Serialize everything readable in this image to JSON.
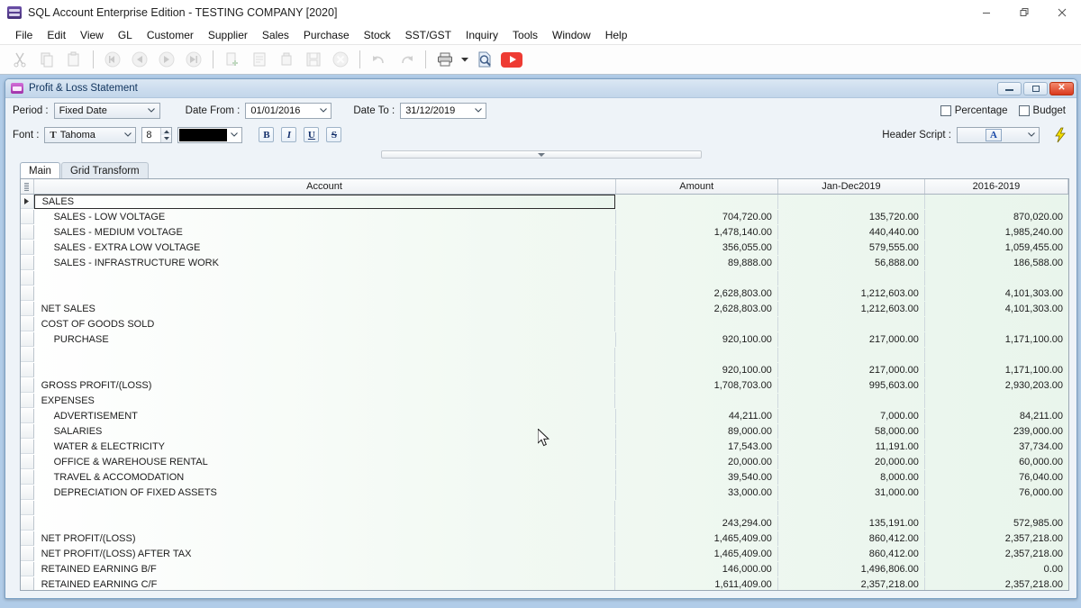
{
  "window": {
    "title": "SQL Account Enterprise Edition - TESTING COMPANY [2020]",
    "app_icon": "sql-account-icon",
    "controls": {
      "minimize": "minimize-icon",
      "restore": "restore-icon",
      "close": "close-icon"
    }
  },
  "menubar": {
    "items": [
      {
        "label": "File",
        "accel": "F"
      },
      {
        "label": "Edit",
        "accel": "E"
      },
      {
        "label": "View",
        "accel": "V"
      },
      {
        "label": "GL",
        "accel": "L"
      },
      {
        "label": "Customer",
        "accel": "C"
      },
      {
        "label": "Supplier",
        "accel": "u"
      },
      {
        "label": "Sales",
        "accel": "S"
      },
      {
        "label": "Purchase",
        "accel": "P"
      },
      {
        "label": "Stock",
        "accel": "k"
      },
      {
        "label": "SST/GST",
        "accel": "G"
      },
      {
        "label": "Inquiry",
        "accel": "I"
      },
      {
        "label": "Tools",
        "accel": "T"
      },
      {
        "label": "Window",
        "accel": "W"
      },
      {
        "label": "Help",
        "accel": "H"
      }
    ]
  },
  "toolbar": {
    "buttons": [
      {
        "name": "cut-icon",
        "enabled": false
      },
      {
        "name": "copy-icon",
        "enabled": false
      },
      {
        "name": "paste-icon",
        "enabled": false
      },
      {
        "name": "first-record-icon",
        "enabled": false
      },
      {
        "name": "previous-record-icon",
        "enabled": false
      },
      {
        "name": "next-record-icon",
        "enabled": false
      },
      {
        "name": "last-record-icon",
        "enabled": false
      },
      {
        "name": "add-record-icon",
        "enabled": false
      },
      {
        "name": "edit-record-icon",
        "enabled": false
      },
      {
        "name": "delete-record-icon",
        "enabled": false
      },
      {
        "name": "save-record-icon",
        "enabled": false
      },
      {
        "name": "cancel-record-icon",
        "enabled": false
      },
      {
        "name": "undo-icon",
        "enabled": false
      },
      {
        "name": "redo-icon",
        "enabled": false
      },
      {
        "name": "print-icon",
        "enabled": true
      },
      {
        "name": "print-preview-icon",
        "enabled": true
      },
      {
        "name": "youtube-icon",
        "enabled": true
      }
    ]
  },
  "report_window": {
    "title": "Profit & Loss Statement",
    "icon": "report-window-icon",
    "controls": {
      "minimize": "minimize-icon",
      "maximize": "maximize-icon",
      "close": "close-icon"
    },
    "params": {
      "period_label": "Period :",
      "period_value": "Fixed Date",
      "date_from_label": "Date From :",
      "date_from_value": "01/01/2016",
      "date_to_label": "Date To :",
      "date_to_value": "31/12/2019",
      "percentage_label": "Percentage",
      "percentage_checked": false,
      "budget_label": "Budget",
      "budget_checked": false
    },
    "format_bar": {
      "font_label": "Font :",
      "font_value": "Tahoma",
      "font_icon": "font-type-icon",
      "size_value": "8",
      "color_value": "#000000",
      "bold_label": "B",
      "italic_label": "I",
      "underline_label": "U",
      "strikeout_label": "S",
      "header_script_label": "Header Script :",
      "header_script_value": "A",
      "script_run_icon": "lightning-bolt-icon"
    },
    "tabs": [
      {
        "label": "Main",
        "active": true
      },
      {
        "label": "Grid Transform",
        "active": false
      }
    ]
  },
  "grid": {
    "columns": [
      "Account",
      "Amount",
      "Jan-Dec2019",
      "2016-2019"
    ],
    "rows": [
      {
        "type": "header",
        "account": "SALES",
        "amount": "",
        "jan": "",
        "y2016": "",
        "selected": true
      },
      {
        "type": "detail",
        "account": "SALES - LOW VOLTAGE",
        "amount": "704,720.00",
        "jan": "135,720.00",
        "y2016": "870,020.00"
      },
      {
        "type": "detail",
        "account": "SALES - MEDIUM VOLTAGE",
        "amount": "1,478,140.00",
        "jan": "440,440.00",
        "y2016": "1,985,240.00"
      },
      {
        "type": "detail",
        "account": "SALES - EXTRA LOW VOLTAGE",
        "amount": "356,055.00",
        "jan": "579,555.00",
        "y2016": "1,059,455.00"
      },
      {
        "type": "detail",
        "account": "SALES - INFRASTRUCTURE WORK",
        "amount": "89,888.00",
        "jan": "56,888.00",
        "y2016": "186,588.00"
      },
      {
        "type": "total",
        "account": "",
        "amount": "2,628,803.00",
        "jan": "1,212,603.00",
        "y2016": "4,101,303.00"
      },
      {
        "type": "header",
        "account": "NET SALES",
        "amount": "2,628,803.00",
        "jan": "1,212,603.00",
        "y2016": "4,101,303.00"
      },
      {
        "type": "header",
        "account": "COST OF GOODS SOLD",
        "amount": "",
        "jan": "",
        "y2016": ""
      },
      {
        "type": "detail",
        "account": "PURCHASE",
        "amount": "920,100.00",
        "jan": "217,000.00",
        "y2016": "1,171,100.00"
      },
      {
        "type": "total",
        "account": "",
        "amount": "920,100.00",
        "jan": "217,000.00",
        "y2016": "1,171,100.00"
      },
      {
        "type": "header",
        "account": "GROSS PROFIT/(LOSS)",
        "amount": "1,708,703.00",
        "jan": "995,603.00",
        "y2016": "2,930,203.00"
      },
      {
        "type": "header",
        "account": "EXPENSES",
        "amount": "",
        "jan": "",
        "y2016": ""
      },
      {
        "type": "detail",
        "account": "ADVERTISEMENT",
        "amount": "44,211.00",
        "jan": "7,000.00",
        "y2016": "84,211.00"
      },
      {
        "type": "detail",
        "account": "SALARIES",
        "amount": "89,000.00",
        "jan": "58,000.00",
        "y2016": "239,000.00"
      },
      {
        "type": "detail",
        "account": "WATER & ELECTRICITY",
        "amount": "17,543.00",
        "jan": "11,191.00",
        "y2016": "37,734.00"
      },
      {
        "type": "detail",
        "account": "OFFICE & WAREHOUSE RENTAL",
        "amount": "20,000.00",
        "jan": "20,000.00",
        "y2016": "60,000.00"
      },
      {
        "type": "detail",
        "account": "TRAVEL & ACCOMODATION",
        "amount": "39,540.00",
        "jan": "8,000.00",
        "y2016": "76,040.00"
      },
      {
        "type": "detail",
        "account": "DEPRECIATION OF FIXED ASSETS",
        "amount": "33,000.00",
        "jan": "31,000.00",
        "y2016": "76,000.00"
      },
      {
        "type": "total",
        "account": "",
        "amount": "243,294.00",
        "jan": "135,191.00",
        "y2016": "572,985.00"
      },
      {
        "type": "header",
        "account": "NET PROFIT/(LOSS)",
        "amount": "1,465,409.00",
        "jan": "860,412.00",
        "y2016": "2,357,218.00"
      },
      {
        "type": "header",
        "account": "NET PROFIT/(LOSS) AFTER TAX",
        "amount": "1,465,409.00",
        "jan": "860,412.00",
        "y2016": "2,357,218.00"
      },
      {
        "type": "header",
        "account": "RETAINED EARNING B/F",
        "amount": "146,000.00",
        "jan": "1,496,806.00",
        "y2016": "0.00"
      },
      {
        "type": "header",
        "account": "RETAINED EARNING C/F",
        "amount": "1,611,409.00",
        "jan": "2,357,218.00",
        "y2016": "2,357,218.00"
      }
    ]
  },
  "colors": {
    "header_text": "#2121d0",
    "grid_row_tint": "#e9f5ec",
    "mdi_background": "#b1cce8",
    "close_button": "#d9381d",
    "youtube_red": "#ee3b33"
  }
}
